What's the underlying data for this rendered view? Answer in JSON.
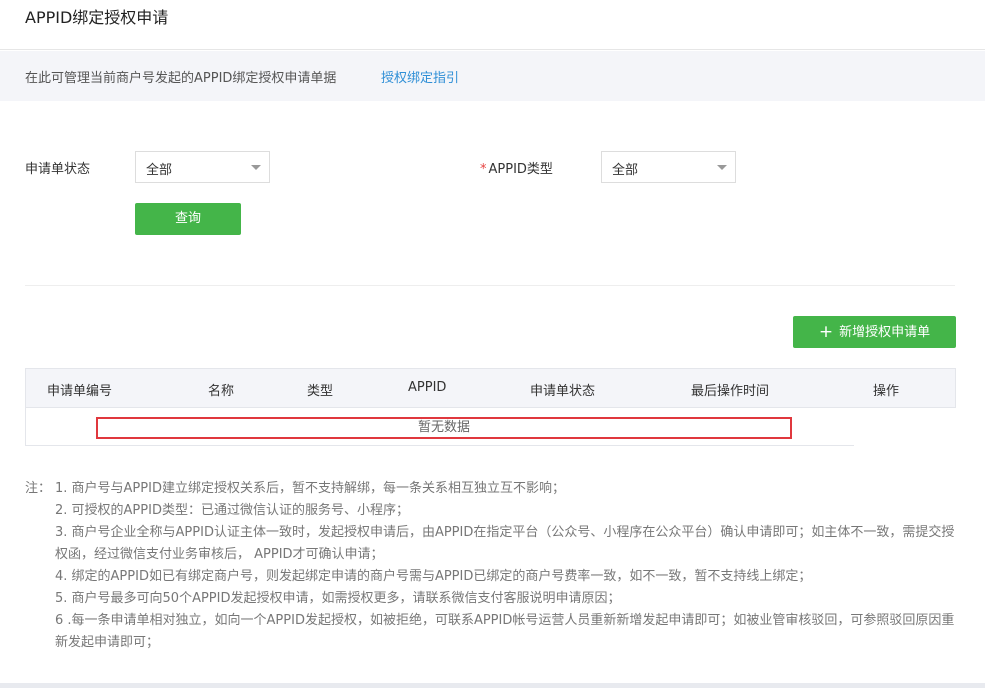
{
  "header": {
    "title": "APPID绑定授权申请"
  },
  "info": {
    "text": "在此可管理当前商户号发起的APPID绑定授权申请单据",
    "link": "授权绑定指引"
  },
  "filters": {
    "status_label": "申请单状态",
    "status_value": "全部",
    "type_required": "*",
    "type_label": "APPID类型",
    "type_value": "全部",
    "query_button": "查询"
  },
  "actions": {
    "add_button": "新增授权申请单",
    "add_icon": "plus-icon"
  },
  "table": {
    "columns": [
      "申请单编号",
      "名称",
      "类型",
      "APPID",
      "申请单状态",
      "最后操作时间",
      "操作"
    ],
    "empty_text": "暂无数据"
  },
  "notes": {
    "prefix": "注：",
    "lines": [
      "1. 商户号与APPID建立绑定授权关系后，暂不支持解绑，每一条关系相互独立互不影响；",
      "2. 可授权的APPID类型：已通过微信认证的服务号、小程序；",
      "3. 商户号企业全称与APPID认证主体一致时，发起授权申请后，由APPID在指定平台（公众号、小程序在公众平台）确认申请即可；如主体不一致，需提交授权函，经过微信支付业务审核后， APPID才可确认申请；",
      "4. 绑定的APPID如已有绑定商户号，则发起绑定申请的商户号需与APPID已绑定的商户号费率一致，如不一致，暂不支持线上绑定；",
      "5. 商户号最多可向50个APPID发起授权申请，如需授权更多，请联系微信支付客服说明申请原因；",
      "6 .每一条申请单相对独立，如向一个APPID发起授权，如被拒绝，可联系APPID帐号运营人员重新新增发起申请即可；如被业管审核驳回，可参照驳回原因重新发起申请即可；"
    ]
  },
  "colors": {
    "accent_green": "#44b549",
    "link_blue": "#2f8fd6",
    "highlight_red": "#e0383e"
  }
}
